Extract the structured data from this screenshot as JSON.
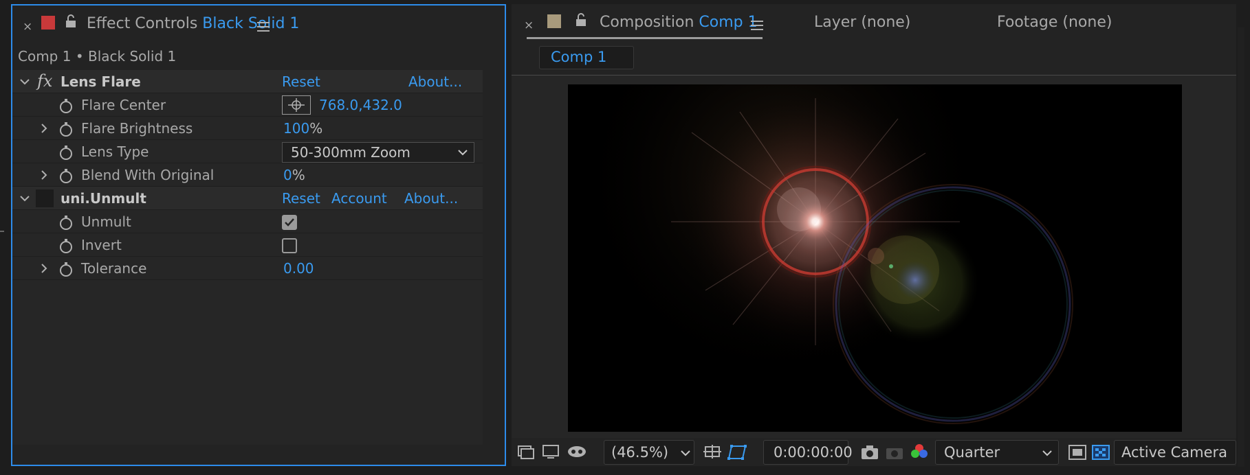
{
  "effect_controls": {
    "close_glyph": "×",
    "label_color": "#c8393a",
    "title_prefix": "Effect Controls",
    "title_layer": "Black Solid 1",
    "breadcrumb": "Comp 1 • Black Solid 1",
    "effects": [
      {
        "name": "Lens Flare",
        "fx_glyph": "fx",
        "reset": "Reset",
        "about": "About...",
        "params": [
          {
            "label": "Flare Center",
            "value": "768.0,432.0"
          },
          {
            "label": "Flare Brightness",
            "value": "100",
            "unit": "%"
          },
          {
            "label": "Lens Type",
            "value": "50-300mm Zoom"
          },
          {
            "label": "Blend With Original",
            "value": "0",
            "unit": "%"
          }
        ]
      },
      {
        "name": "uni.Unmult",
        "reset": "Reset",
        "account": "Account",
        "about": "About...",
        "params": [
          {
            "label": "Unmult",
            "checked": true
          },
          {
            "label": "Invert",
            "checked": false
          },
          {
            "label": "Tolerance",
            "value": "0.00"
          }
        ]
      }
    ]
  },
  "composition": {
    "close_glyph": "×",
    "label_color": "#a89a7c",
    "title_prefix": "Composition",
    "title_comp": "Comp 1",
    "layer_tab": "Layer (none)",
    "footage_tab": "Footage (none)",
    "active_subtab": "Comp 1",
    "toolbar": {
      "zoom": "(46.5%)",
      "timecode": "0:00:00:00",
      "resolution": "Quarter",
      "camera": "Active Camera"
    }
  },
  "colors": {
    "accent": "#3a9bf0",
    "panel_border": "#2d8ceb"
  }
}
